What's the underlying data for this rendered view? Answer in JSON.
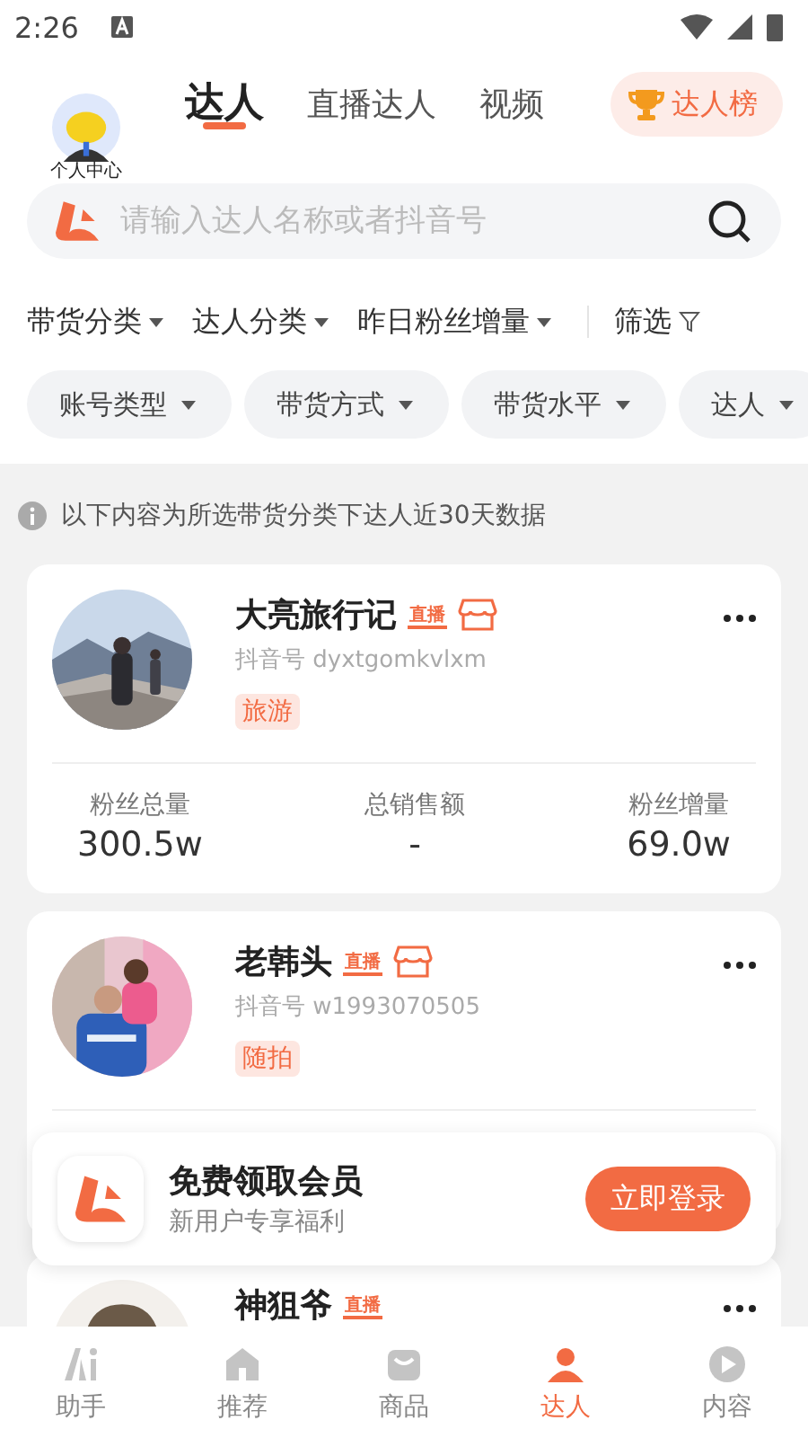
{
  "status_bar": {
    "time": "2:26"
  },
  "header": {
    "avatar_label": "个人中心",
    "tabs": [
      {
        "label": "达人",
        "selected": true
      },
      {
        "label": "直播达人",
        "selected": false
      },
      {
        "label": "视频",
        "selected": false
      }
    ],
    "ranking_button": "达人榜"
  },
  "search": {
    "placeholder": "请输入达人名称或者抖音号"
  },
  "filters": [
    {
      "label": "带货分类",
      "kind": "dropdown"
    },
    {
      "label": "达人分类",
      "kind": "dropdown"
    },
    {
      "label": "昨日粉丝增量",
      "kind": "dropdown"
    },
    {
      "label": "筛选",
      "kind": "filter"
    }
  ],
  "chips": [
    "账号类型",
    "带货方式",
    "带货水平",
    "达人"
  ],
  "notice": "以下内容为所选带货分类下达人近30天数据",
  "cards": [
    {
      "name": "大亮旅行记",
      "live_badge": "直播",
      "shop": true,
      "account": "抖音号 dyxtgomkvlxm",
      "tag": "旅游",
      "stats": [
        {
          "label": "粉丝总量",
          "value": "300.5w"
        },
        {
          "label": "总销售额",
          "value": "-"
        },
        {
          "label": "粉丝增量",
          "value": "69.0w"
        }
      ]
    },
    {
      "name": "老韩头",
      "live_badge": "直播",
      "shop": true,
      "account": "抖音号 w1993070505",
      "tag": "随拍"
    },
    {
      "name": "神狙爷",
      "live_badge": "直播",
      "shop": false
    }
  ],
  "promo": {
    "title": "免费领取会员",
    "subtitle": "新用户专享福利",
    "button": "立即登录"
  },
  "nav": [
    {
      "label": "助手",
      "kind": "ai",
      "selected": false
    },
    {
      "label": "推荐",
      "kind": "home",
      "selected": false
    },
    {
      "label": "商品",
      "kind": "bag",
      "selected": false
    },
    {
      "label": "达人",
      "kind": "person",
      "selected": true
    },
    {
      "label": "内容",
      "kind": "play",
      "selected": false
    }
  ]
}
